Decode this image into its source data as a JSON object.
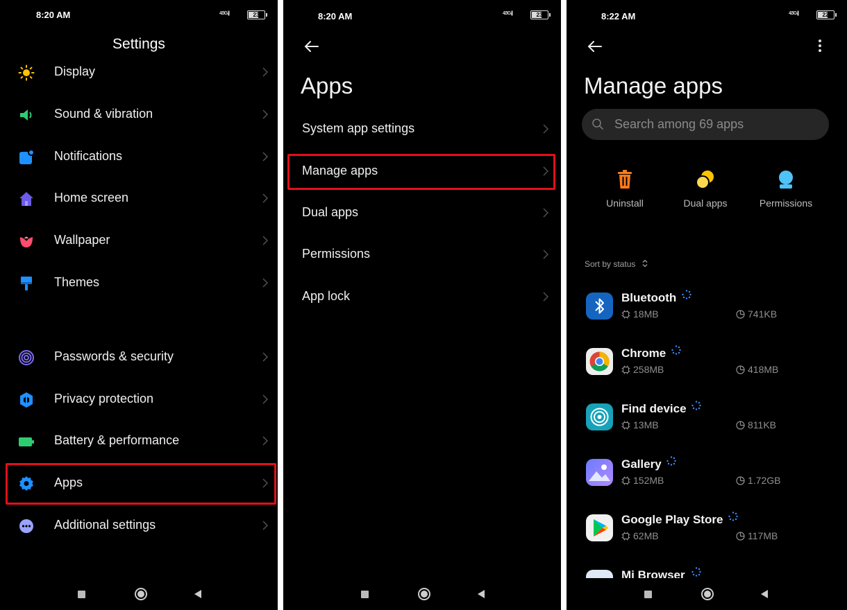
{
  "screen1": {
    "time": "8:20 AM",
    "signal": "4.5G ᵢ||",
    "battery": "23",
    "title": "Settings",
    "items": [
      {
        "label": "Display",
        "icon": "sun-icon"
      },
      {
        "label": "Sound & vibration",
        "icon": "speaker-icon"
      },
      {
        "label": "Notifications",
        "icon": "notification-icon"
      },
      {
        "label": "Home screen",
        "icon": "home-icon"
      },
      {
        "label": "Wallpaper",
        "icon": "flower-icon"
      },
      {
        "label": "Themes",
        "icon": "brush-icon"
      },
      {
        "label": "Passwords & security",
        "icon": "fingerprint-icon"
      },
      {
        "label": "Privacy protection",
        "icon": "privacy-icon"
      },
      {
        "label": "Battery & performance",
        "icon": "battery-icon"
      },
      {
        "label": "Apps",
        "icon": "gear-icon"
      },
      {
        "label": "Additional settings",
        "icon": "more-dots-icon"
      }
    ]
  },
  "screen2": {
    "time": "8:20 AM",
    "signal": "4.5G ᵢ||",
    "battery": "23",
    "title": "Apps",
    "items": [
      {
        "label": "System app settings"
      },
      {
        "label": "Manage apps"
      },
      {
        "label": "Dual apps"
      },
      {
        "label": "Permissions"
      },
      {
        "label": "App lock"
      }
    ]
  },
  "screen3": {
    "time": "8:22 AM",
    "signal": "4.5G ᵢ||",
    "battery": "22",
    "title": "Manage apps",
    "search_placeholder": "Search among 69 apps",
    "actions": [
      {
        "label": "Uninstall",
        "icon": "trash-icon"
      },
      {
        "label": "Dual apps",
        "icon": "dual-apps-icon"
      },
      {
        "label": "Permissions",
        "icon": "permissions-icon"
      }
    ],
    "sort_label": "Sort by status",
    "apps": [
      {
        "name": "Bluetooth",
        "size": "18MB",
        "data": "741KB",
        "icon": "bluetooth-icon"
      },
      {
        "name": "Chrome",
        "size": "258MB",
        "data": "418MB",
        "icon": "chrome-icon"
      },
      {
        "name": "Find device",
        "size": "13MB",
        "data": "811KB",
        "icon": "find-device-icon"
      },
      {
        "name": "Gallery",
        "size": "152MB",
        "data": "1.72GB",
        "icon": "gallery-icon"
      },
      {
        "name": "Google Play Store",
        "size": "62MB",
        "data": "117MB",
        "icon": "play-store-icon"
      },
      {
        "name": "Mi Browser",
        "size": "",
        "data": "",
        "icon": "mi-browser-icon"
      }
    ]
  },
  "colors": {
    "highlight": "#e0101a",
    "background": "#000000",
    "uninstall_orange": "#ff7a1a",
    "dual_yellow": "#ffc400",
    "permission_blue": "#4fc3f7"
  }
}
